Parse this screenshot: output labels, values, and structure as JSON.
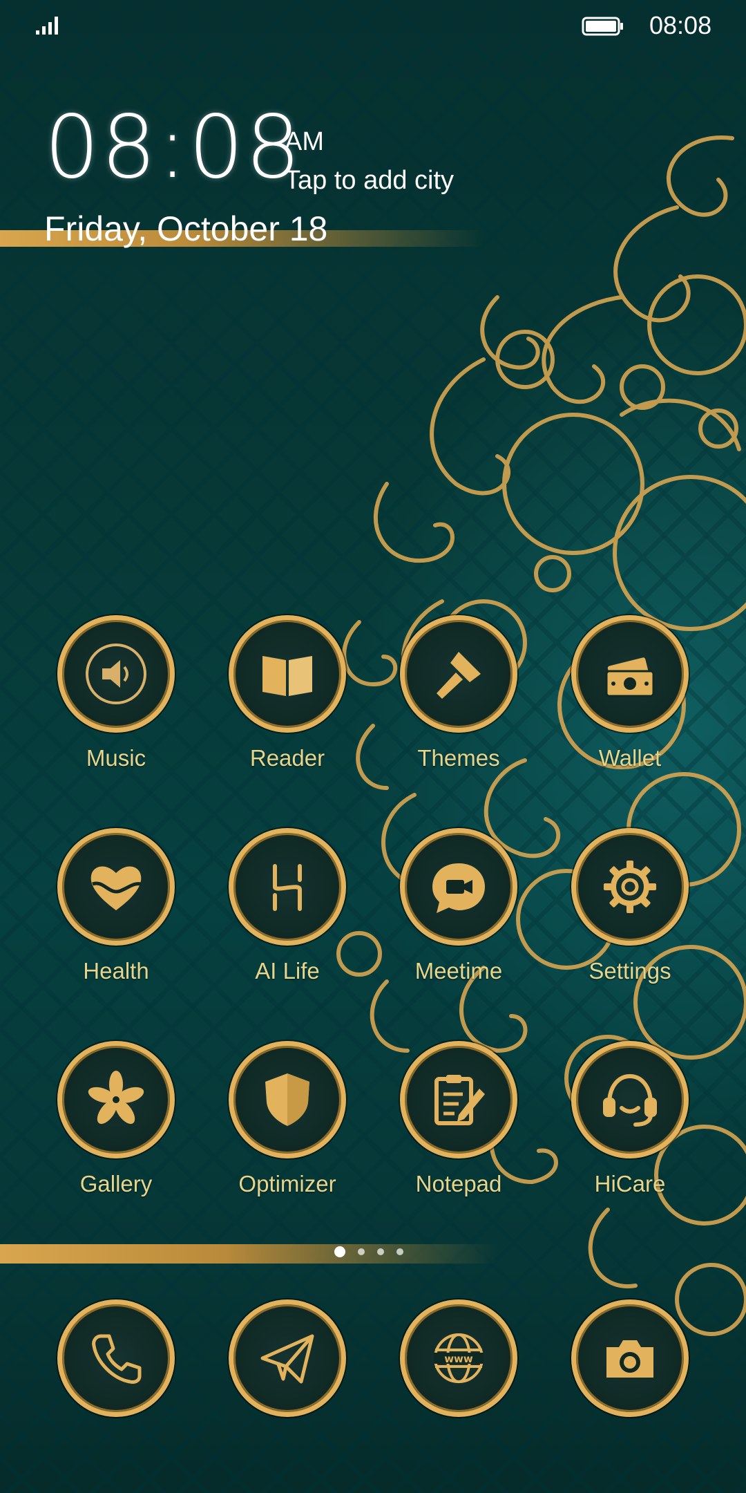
{
  "status_bar": {
    "time": "08:08",
    "signal_icon": "signal-icon",
    "battery_icon": "battery-icon"
  },
  "clock_widget": {
    "time": "08:08",
    "ampm": "AM",
    "city_prompt": "Tap to add city",
    "date": "Friday, October 18"
  },
  "apps": [
    {
      "label": "Music",
      "icon": "speaker-icon"
    },
    {
      "label": "Reader",
      "icon": "book-icon"
    },
    {
      "label": "Themes",
      "icon": "paintbrush-icon"
    },
    {
      "label": "Wallet",
      "icon": "money-icon"
    },
    {
      "label": "Health",
      "icon": "heart-icon"
    },
    {
      "label": "AI Life",
      "icon": "ai-life-icon"
    },
    {
      "label": "Meetime",
      "icon": "video-chat-icon"
    },
    {
      "label": "Settings",
      "icon": "gear-icon"
    },
    {
      "label": "Gallery",
      "icon": "flower-icon"
    },
    {
      "label": "Optimizer",
      "icon": "shield-icon"
    },
    {
      "label": "Notepad",
      "icon": "notepad-icon"
    },
    {
      "label": "HiCare",
      "icon": "headset-icon"
    }
  ],
  "dock": [
    {
      "icon": "phone-icon"
    },
    {
      "icon": "paper-plane-icon"
    },
    {
      "icon": "globe-www-icon"
    },
    {
      "icon": "camera-icon"
    }
  ],
  "page_indicator": {
    "pages": 4,
    "current": 1
  },
  "colors": {
    "gold": "#e2b35c",
    "label_gold": "#e6d58c",
    "background_teal": "#073936"
  }
}
